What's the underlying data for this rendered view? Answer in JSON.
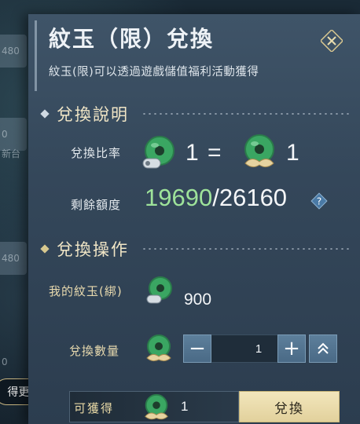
{
  "background": {
    "chips": [
      "480",
      "0",
      "新台",
      "480",
      "0"
    ]
  },
  "dialog": {
    "title": "紋玉（限）兌換",
    "subtitle": "紋玉(限)可以透過遊戲儲值福利活動獲得"
  },
  "rate_section": {
    "heading": "兌換說明",
    "rate_label": "兌換比率",
    "rate_left": "1",
    "rate_equals": "=",
    "rate_right": "1",
    "quota_label": "剩餘額度",
    "quota_current": "19690",
    "quota_separator": "/",
    "quota_total": "26160"
  },
  "operation_section": {
    "heading": "兌換操作",
    "owned_label": "我的紋玉(綁)",
    "owned_value": "900",
    "qty_label": "兌換數量",
    "qty_value": "1",
    "minus": "−",
    "plus": "+"
  },
  "footer": {
    "more_label": "得更多",
    "obtain_label": "可獲得",
    "obtain_value": "1",
    "exchange_label": "兌換"
  },
  "colors": {
    "quota_current": "#9ee39a",
    "section_heading": "#f1e6c6",
    "exchange_button": "#e9dba8"
  },
  "icons": [
    "close-icon",
    "diamond-bullet-icon",
    "jade-coin-icon",
    "help-icon",
    "chevron-up-icon"
  ]
}
